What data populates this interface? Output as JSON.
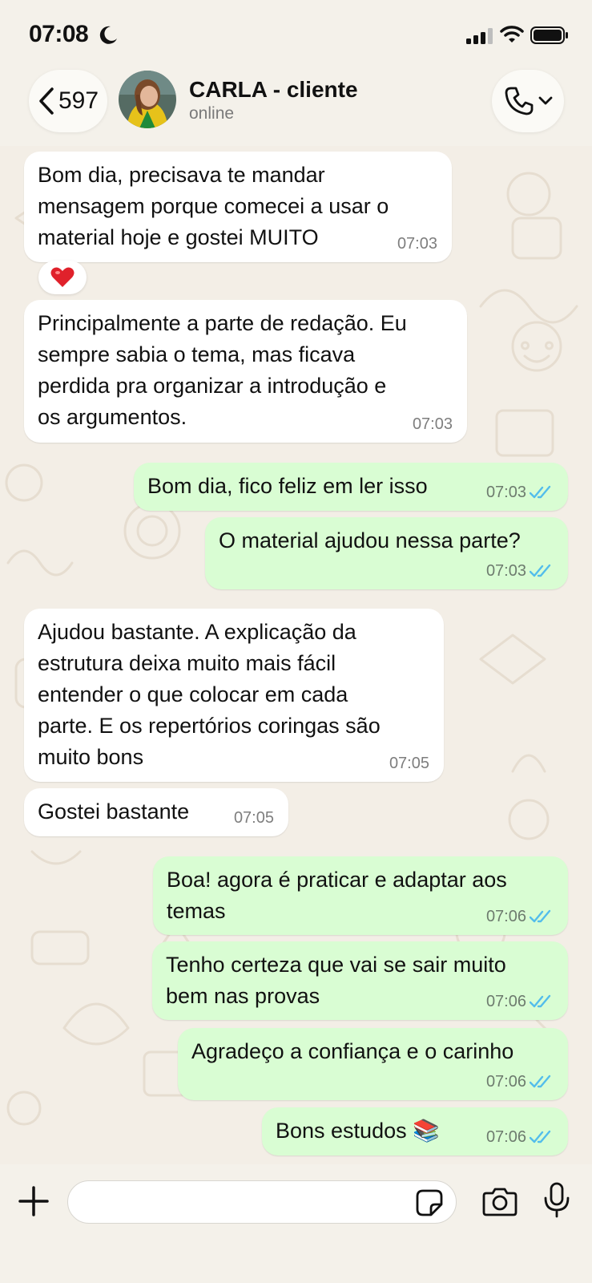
{
  "status_bar": {
    "time": "07:08"
  },
  "header": {
    "back_count": "597",
    "contact_name": "CARLA - cliente",
    "contact_status": "online"
  },
  "messages": [
    {
      "direction": "in",
      "text": "Bom dia, precisava te mandar\nmensagem porque comecei a usar o\nmaterial hoje e gostei MUITO",
      "time": "07:03",
      "reaction": "❤️"
    },
    {
      "direction": "in",
      "text": "Principalmente a parte de redação. Eu\nsempre sabia o tema, mas ficava\nperdida pra organizar a introdução e\nos argumentos.",
      "time": "07:03"
    },
    {
      "direction": "out",
      "text": "Bom dia, fico feliz em ler isso",
      "time": "07:03",
      "status": "read"
    },
    {
      "direction": "out",
      "text": "O material ajudou nessa parte?",
      "time": "07:03",
      "status": "read"
    },
    {
      "direction": "in",
      "text": "Ajudou bastante. A explicação da\nestrutura deixa muito mais fácil\nentender o que colocar em cada\nparte. E os repertórios coringas são\nmuito bons",
      "time": "07:05"
    },
    {
      "direction": "in",
      "text": "Gostei bastante",
      "time": "07:05"
    },
    {
      "direction": "out",
      "text": "Boa! agora é praticar e adaptar aos\ntemas",
      "time": "07:06",
      "status": "read"
    },
    {
      "direction": "out",
      "text": "Tenho certeza que vai se sair muito\nbem nas provas",
      "time": "07:06",
      "status": "read"
    },
    {
      "direction": "out",
      "text": "Agradeço a confiança e o carinho",
      "time": "07:06",
      "status": "read"
    },
    {
      "direction": "out",
      "text": "Bons estudos 📚",
      "time": "07:06",
      "status": "read"
    }
  ],
  "input": {
    "placeholder": ""
  },
  "colors": {
    "outgoing_bubble": "#d9fdd3",
    "incoming_bubble": "#ffffff",
    "read_tick": "#53bdeb",
    "background": "#f4f1ea"
  },
  "icons": {
    "status": [
      "moon-icon",
      "signal-icon",
      "wifi-icon",
      "battery-icon"
    ],
    "header": [
      "chevron-left-icon",
      "phone-icon",
      "chevron-down-icon"
    ],
    "input": [
      "plus-icon",
      "sticker-icon",
      "camera-icon",
      "microphone-icon"
    ]
  }
}
